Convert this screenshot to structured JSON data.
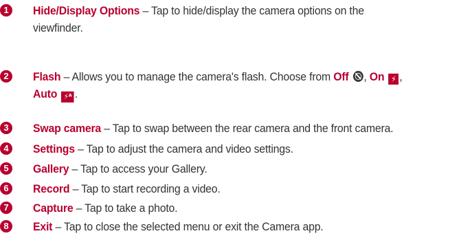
{
  "items": [
    {
      "number": "1",
      "term": "Hide/Display Options",
      "desc_line1": " – Tap to hide/display the camera options on the",
      "desc_line2": "viewfinder."
    },
    {
      "number": "2",
      "term": "Flash",
      "desc_line1": " – Allows you to manage the camera's flash. Choose from ",
      "option_off": "Off",
      "sep1": ", ",
      "option_on": "On",
      "sep2": ",",
      "option_auto": "Auto",
      "end": ".",
      "icon_off": "flash-off-icon",
      "icon_on": "flash-on-icon",
      "icon_auto": "flash-auto-icon"
    },
    {
      "number": "3",
      "term": "Swap camera",
      "desc_line1": " – Tap to swap between the rear camera and the front camera."
    },
    {
      "number": "4",
      "term": "Settings",
      "desc_line1": " – Tap to adjust the camera and video settings."
    },
    {
      "number": "5",
      "term": "Gallery",
      "desc_line1": " – Tap to access your Gallery."
    },
    {
      "number": "6",
      "term": "Record",
      "desc_line1": " – Tap to start recording a video."
    },
    {
      "number": "7",
      "term": "Capture",
      "desc_line1": " – Tap to take a photo."
    },
    {
      "number": "8",
      "term": "Exit",
      "desc_line1": " – Tap to close the selected menu or exit the Camera app."
    }
  ],
  "colors": {
    "accent": "#b8002f",
    "text": "#333333"
  }
}
